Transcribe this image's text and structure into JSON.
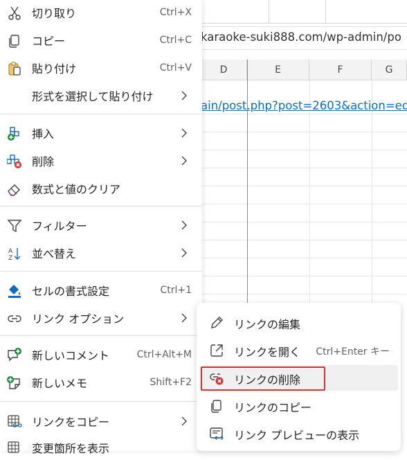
{
  "sheet": {
    "formula_text": "karaoke-suki888.com/wp-admin/po",
    "columns": [
      "D",
      "E",
      "F",
      "G"
    ],
    "link_cell_text": "ain/post.php?post=2603&action=ed"
  },
  "context_menu": {
    "items": [
      {
        "label": "切り取り",
        "shortcut": "Ctrl+X",
        "icon": "scissors-icon"
      },
      {
        "label": "コピー",
        "shortcut": "Ctrl+C",
        "icon": "copy-icon"
      },
      {
        "label": "貼り付け",
        "shortcut": "Ctrl+V",
        "icon": "paste-icon"
      },
      {
        "label": "形式を選択して貼り付け",
        "icon": "none",
        "submenu": true
      },
      {
        "label": "挿入",
        "icon": "insert-icon",
        "submenu": true
      },
      {
        "label": "削除",
        "icon": "delete-cells-icon",
        "submenu": true
      },
      {
        "label": "数式と値のクリア",
        "icon": "eraser-icon"
      },
      {
        "label": "フィルター",
        "icon": "filter-icon",
        "submenu": true
      },
      {
        "label": "並べ替え",
        "icon": "sort-icon",
        "submenu": true
      },
      {
        "label": "セルの書式設定",
        "shortcut": "Ctrl+1",
        "icon": "format-cells-icon"
      },
      {
        "label": "リンク オプション",
        "icon": "link-icon",
        "submenu": true
      },
      {
        "label": "新しいコメント",
        "shortcut": "Ctrl+Alt+M",
        "icon": "new-comment-icon"
      },
      {
        "label": "新しいメモ",
        "shortcut": "Shift+F2",
        "icon": "new-note-icon"
      },
      {
        "label": "リンクをコピー",
        "icon": "copy-link-table-icon",
        "submenu": true
      },
      {
        "label": "変更箇所を表示",
        "icon": "show-changes-icon"
      }
    ]
  },
  "link_submenu": {
    "items": [
      {
        "label": "リンクの編集",
        "icon": "pencil-icon"
      },
      {
        "label": "リンクを開く",
        "shortcut": "Ctrl+Enter キー",
        "icon": "open-link-icon"
      },
      {
        "label": "リンクの削除",
        "icon": "remove-link-icon",
        "highlighted": true
      },
      {
        "label": "リンクのコピー",
        "icon": "copy-icon"
      },
      {
        "label": "リンク プレビューの表示",
        "icon": "link-preview-icon"
      }
    ]
  },
  "colors": {
    "accent_green": "#1e8e3e",
    "accent_red": "#d13438",
    "link_blue": "#0f6cbd",
    "highlight_border": "#d13438"
  }
}
